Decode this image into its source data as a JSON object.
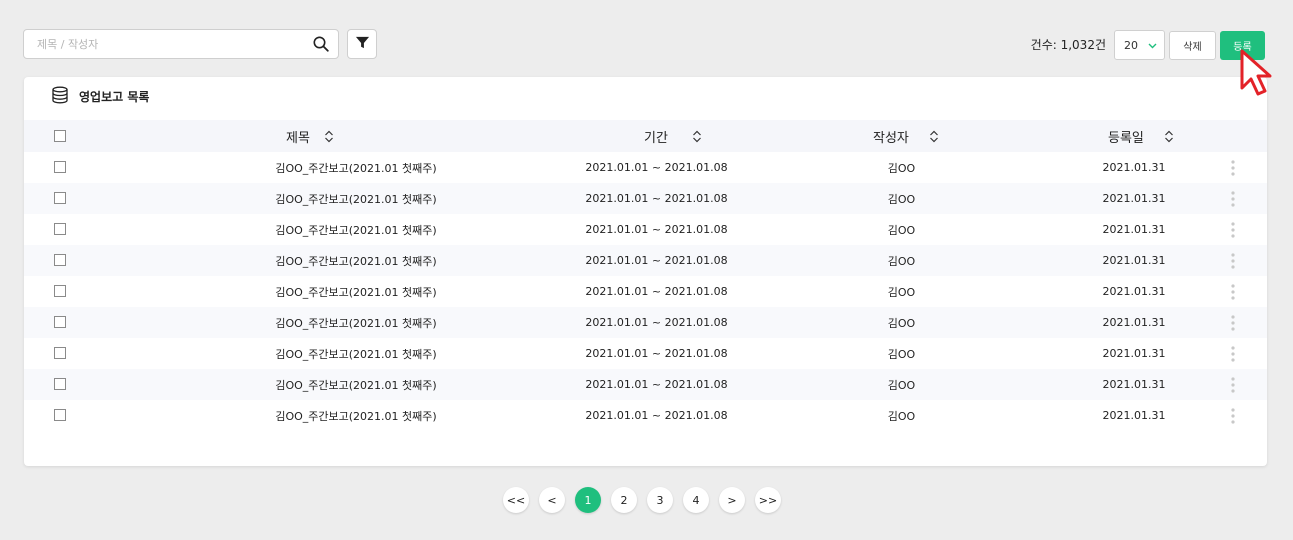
{
  "search": {
    "placeholder": "제목 / 작성자",
    "value": ""
  },
  "toolbar": {
    "count_label": "건수: 1,032건",
    "page_size": "20",
    "delete_label": "삭제",
    "register_label": "등록"
  },
  "card": {
    "title": "영업보고 목록"
  },
  "table": {
    "headers": {
      "title": "제목",
      "period": "기간",
      "writer": "작성자",
      "date": "등록일"
    },
    "rows": [
      {
        "title": "김OO_주간보고(2021.01 첫째주)",
        "period": "2021.01.01 ~ 2021.01.08",
        "writer": "김OO",
        "date": "2021.01.31"
      },
      {
        "title": "김OO_주간보고(2021.01 첫째주)",
        "period": "2021.01.01 ~ 2021.01.08",
        "writer": "김OO",
        "date": "2021.01.31"
      },
      {
        "title": "김OO_주간보고(2021.01 첫째주)",
        "period": "2021.01.01 ~ 2021.01.08",
        "writer": "김OO",
        "date": "2021.01.31"
      },
      {
        "title": "김OO_주간보고(2021.01 첫째주)",
        "period": "2021.01.01 ~ 2021.01.08",
        "writer": "김OO",
        "date": "2021.01.31"
      },
      {
        "title": "김OO_주간보고(2021.01 첫째주)",
        "period": "2021.01.01 ~ 2021.01.08",
        "writer": "김OO",
        "date": "2021.01.31"
      },
      {
        "title": "김OO_주간보고(2021.01 첫째주)",
        "period": "2021.01.01 ~ 2021.01.08",
        "writer": "김OO",
        "date": "2021.01.31"
      },
      {
        "title": "김OO_주간보고(2021.01 첫째주)",
        "period": "2021.01.01 ~ 2021.01.08",
        "writer": "김OO",
        "date": "2021.01.31"
      },
      {
        "title": "김OO_주간보고(2021.01 첫째주)",
        "period": "2021.01.01 ~ 2021.01.08",
        "writer": "김OO",
        "date": "2021.01.31"
      },
      {
        "title": "김OO_주간보고(2021.01 첫째주)",
        "period": "2021.01.01 ~ 2021.01.08",
        "writer": "김OO",
        "date": "2021.01.31"
      }
    ]
  },
  "pagination": {
    "first": "<<",
    "prev": "<",
    "pages": [
      "1",
      "2",
      "3",
      "4"
    ],
    "next": ">",
    "last": ">>",
    "current": "1"
  },
  "icons": {
    "search": "search-icon",
    "filter": "filter-icon",
    "dropdown": "chevron-down-icon",
    "database": "database-icon",
    "sort": "sort-icon",
    "more": "more-vertical-icon",
    "cursor": "mouse-pointer-icon"
  },
  "colors": {
    "accent": "#1fbf7e",
    "background": "#ededed",
    "row_alt": "#f8f9fc",
    "cursor": "#e32228"
  }
}
